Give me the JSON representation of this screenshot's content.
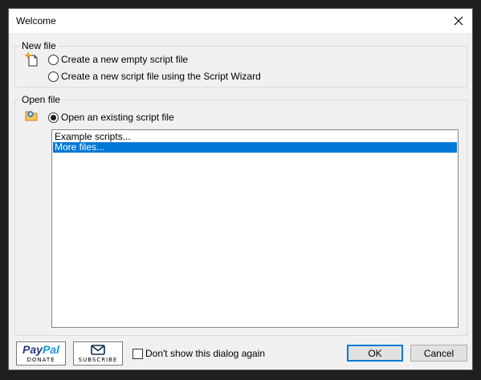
{
  "window": {
    "title": "Welcome"
  },
  "new_file": {
    "legend": "New file",
    "options": [
      {
        "label": "Create a new empty script file",
        "checked": false
      },
      {
        "label": "Create a new script file using the Script Wizard",
        "checked": false
      }
    ]
  },
  "open_file": {
    "legend": "Open file",
    "option": {
      "label": "Open an existing script file",
      "checked": true
    },
    "list": [
      {
        "label": "Example scripts...",
        "selected": false
      },
      {
        "label": "More files...",
        "selected": true
      }
    ]
  },
  "footer": {
    "paypal_word_1": "Pay",
    "paypal_word_2": "Pal",
    "paypal_sub": "DONATE",
    "subscribe_sub": "SUBSCRIBE",
    "dont_show_label": "Don't show this dialog again",
    "ok_label": "OK",
    "cancel_label": "Cancel"
  },
  "colors": {
    "selection": "#0078d7",
    "paypal_dark": "#253b80",
    "paypal_light": "#179bd7"
  }
}
